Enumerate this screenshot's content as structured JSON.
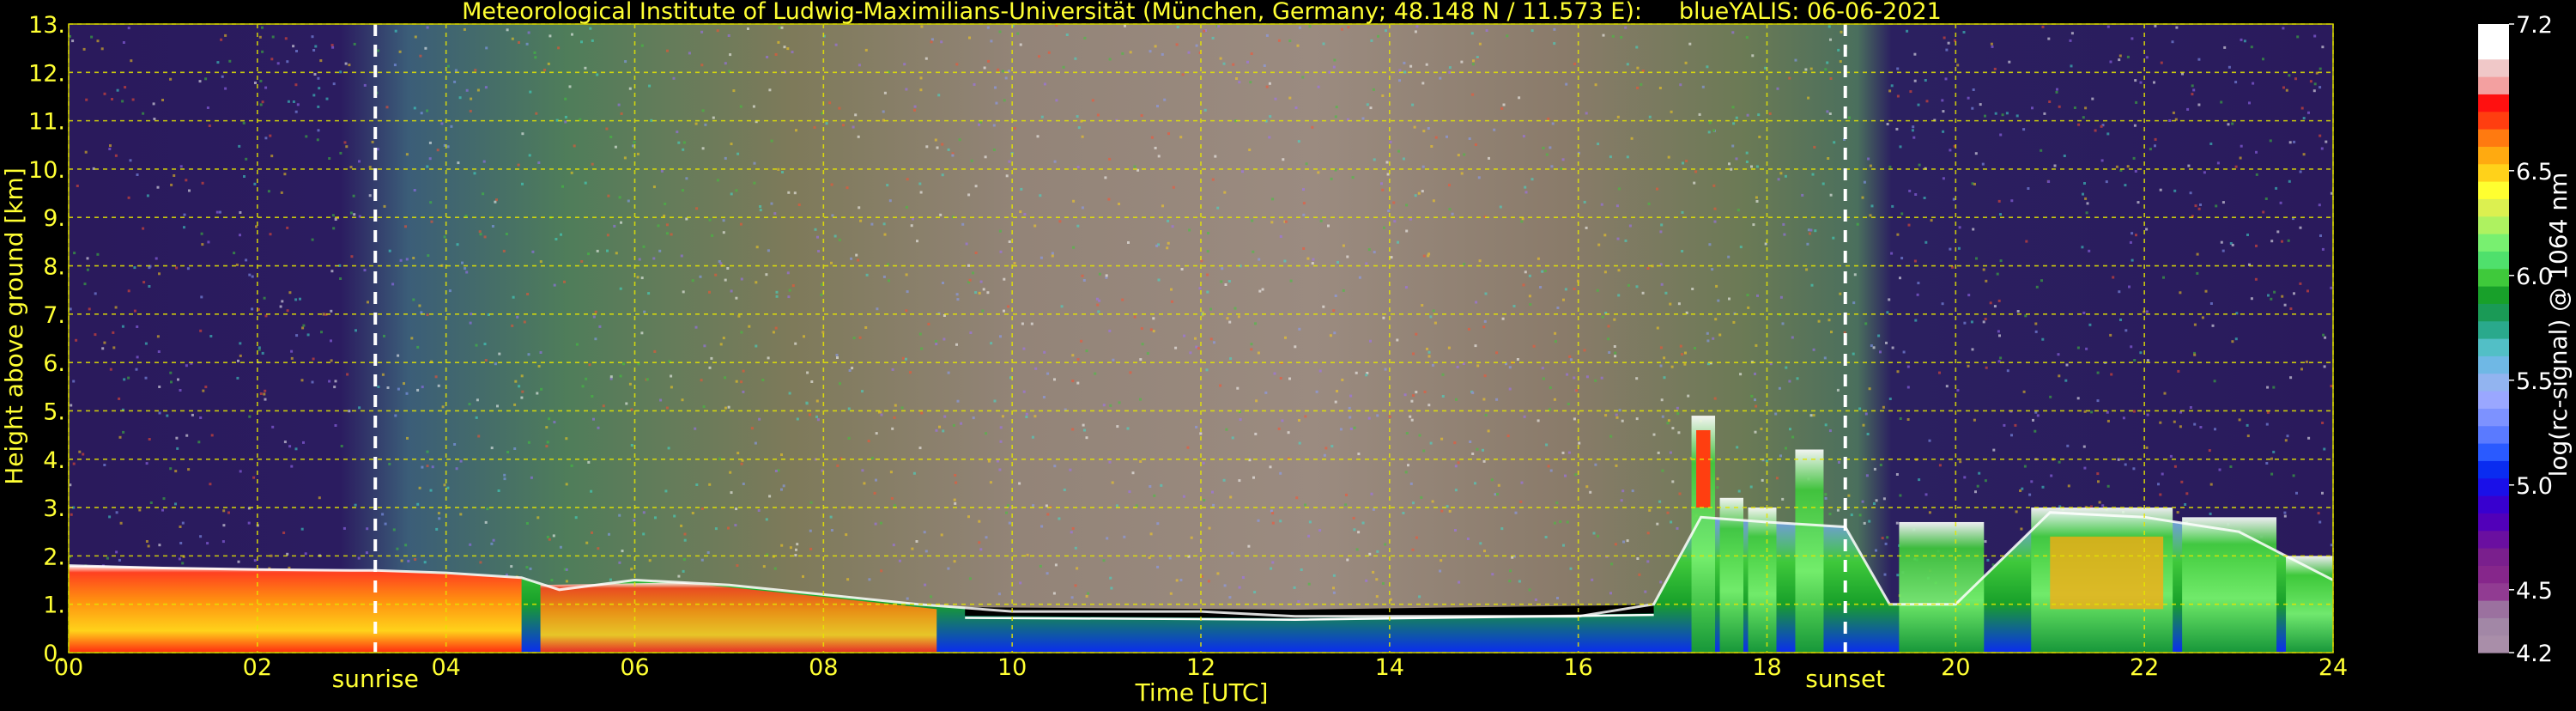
{
  "chart_data": {
    "type": "heatmap",
    "title": "Meteorological Institute of Ludwig-Maximilians-Universität (München, Germany; 48.148 N / 11.573 E):     blueYALIS: 06-06-2021",
    "xlabel": "Time [UTC]",
    "ylabel": "Height above ground [km]",
    "xlim": [
      0,
      24
    ],
    "ylim": [
      0,
      13
    ],
    "xticks": [
      {
        "value": 0,
        "label": "00"
      },
      {
        "value": 2,
        "label": "02"
      },
      {
        "value": 4,
        "label": "04"
      },
      {
        "value": 6,
        "label": "06"
      },
      {
        "value": 8,
        "label": "08"
      },
      {
        "value": 10,
        "label": "10"
      },
      {
        "value": 12,
        "label": "12"
      },
      {
        "value": 14,
        "label": "14"
      },
      {
        "value": 16,
        "label": "16"
      },
      {
        "value": 18,
        "label": "18"
      },
      {
        "value": 20,
        "label": "20"
      },
      {
        "value": 22,
        "label": "22"
      },
      {
        "value": 24,
        "label": "24"
      }
    ],
    "yticks": [
      {
        "value": 0,
        "label": "0."
      },
      {
        "value": 1,
        "label": "1."
      },
      {
        "value": 2,
        "label": "2."
      },
      {
        "value": 3,
        "label": "3."
      },
      {
        "value": 4,
        "label": "4."
      },
      {
        "value": 5,
        "label": "5."
      },
      {
        "value": 6,
        "label": "6."
      },
      {
        "value": 7,
        "label": "7."
      },
      {
        "value": 8,
        "label": "8."
      },
      {
        "value": 9,
        "label": "9."
      },
      {
        "value": 10,
        "label": "10."
      },
      {
        "value": 11,
        "label": "11."
      },
      {
        "value": 12,
        "label": "12."
      },
      {
        "value": 13,
        "label": "13."
      }
    ],
    "grid": true,
    "annotations": [
      {
        "label": "sunrise",
        "x": 3.25
      },
      {
        "label": "sunset",
        "x": 18.83
      }
    ],
    "colorbar": {
      "label": "log(rc-signal) @ 1064 nm",
      "range": [
        4.2,
        7.2
      ],
      "ticks": [
        {
          "value": 4.2,
          "label": "4.2"
        },
        {
          "value": 4.5,
          "label": "4.5"
        },
        {
          "value": 5.0,
          "label": "5.0"
        },
        {
          "value": 5.5,
          "label": "5.5"
        },
        {
          "value": 6.0,
          "label": "6.0"
        },
        {
          "value": 6.5,
          "label": "6.5"
        },
        {
          "value": 7.2,
          "label": "7.2"
        }
      ],
      "colors": [
        "#a98ea9",
        "#a287a6",
        "#9b719f",
        "#913b92",
        "#86268b",
        "#7a1f8d",
        "#6a0fa0",
        "#5100b9",
        "#3800cf",
        "#1a10e8",
        "#0a2cf0",
        "#2a5aff",
        "#5a7aff",
        "#7d92ff",
        "#9aa7ff",
        "#92b4f0",
        "#6fb8e5",
        "#52bfc6",
        "#2aa98c",
        "#1a9a56",
        "#18a02a",
        "#3fc93b",
        "#4fe06c",
        "#78f070",
        "#aef260",
        "#dcf050",
        "#ffff30",
        "#ffd21a",
        "#ffaa10",
        "#ff7a10",
        "#ff3e10",
        "#ff1010",
        "#f3a0a0",
        "#f0c8c8",
        "#ffffff",
        "#ffffff"
      ]
    },
    "boundary_layer_top": {
      "x": [
        0,
        1,
        2,
        3,
        3.25,
        4,
        4.8,
        5.2,
        6,
        7,
        8,
        9,
        10,
        11,
        12,
        13,
        14,
        15,
        16,
        16.8,
        17.3,
        18,
        18.83,
        19.3,
        20,
        21,
        22,
        23,
        24
      ],
      "y": [
        1.8,
        1.75,
        1.72,
        1.7,
        1.7,
        1.65,
        1.55,
        1.3,
        1.5,
        1.4,
        1.2,
        1.0,
        0.85,
        0.85,
        0.85,
        0.75,
        0.75,
        0.75,
        0.75,
        1.0,
        2.8,
        2.7,
        2.6,
        1.0,
        1.0,
        2.9,
        2.8,
        2.5,
        1.5
      ]
    }
  }
}
